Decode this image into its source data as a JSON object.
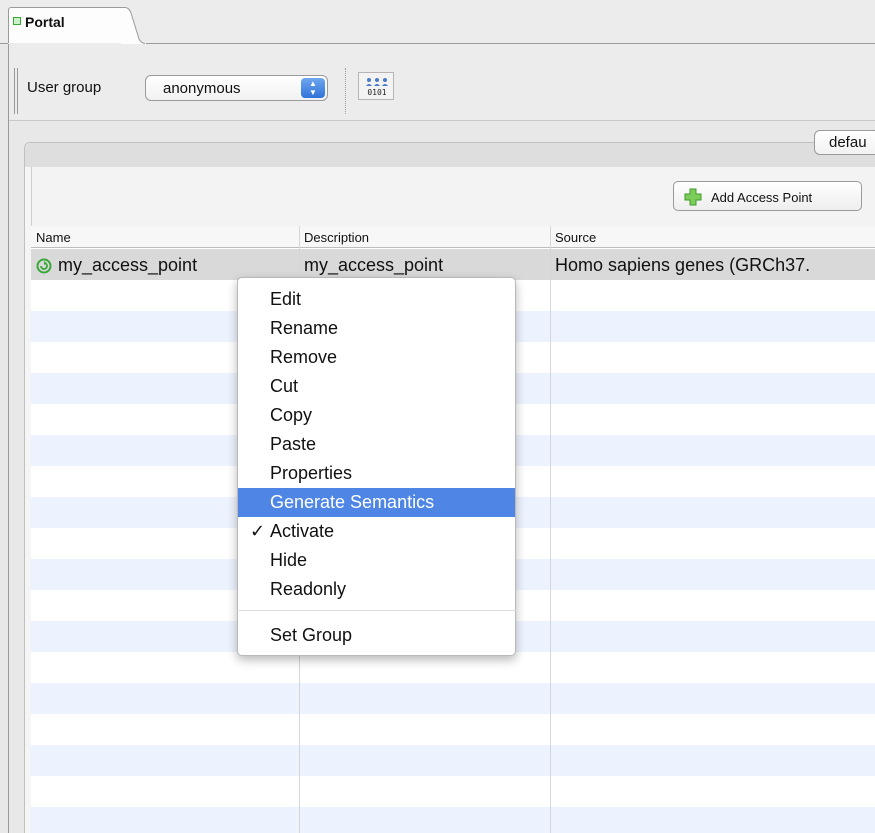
{
  "tab": {
    "label": "Portal"
  },
  "toolbar": {
    "user_group_label": "User group",
    "user_group_value": "anonymous",
    "icon_button": "people-binary-icon"
  },
  "panel": {
    "default_button": "defau",
    "add_button": "Add Access Point"
  },
  "table": {
    "columns": [
      "Name",
      "Description",
      "Source"
    ],
    "rows": [
      {
        "name": "my_access_point",
        "description": "my_access_point",
        "source": "Homo sapiens genes (GRCh37."
      }
    ]
  },
  "context_menu": {
    "items": [
      "Edit",
      "Rename",
      "Remove",
      "Cut",
      "Copy",
      "Paste",
      "Properties",
      "Generate Semantics",
      "Activate",
      "Hide",
      "Readonly",
      "Set Group"
    ],
    "highlighted": "Generate Semantics",
    "checked": "Activate",
    "check_mark": "✓"
  },
  "colors": {
    "highlight": "#4f86e6",
    "alt_row": "#edf3fe",
    "selected_row": "#d9d9d9",
    "status_green": "#39a839"
  }
}
